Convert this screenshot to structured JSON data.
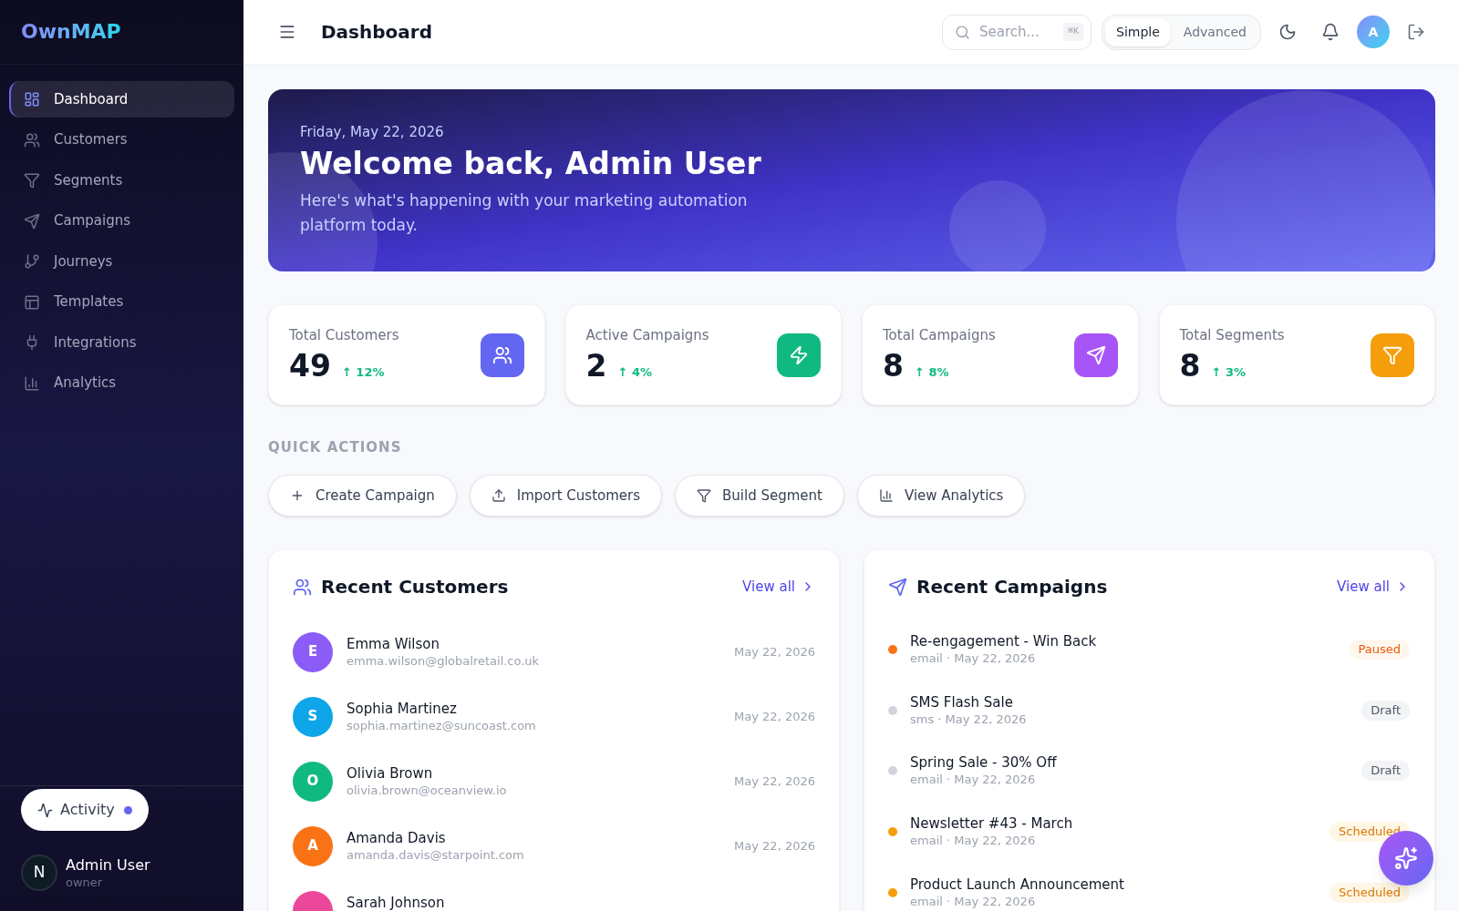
{
  "sidebar": {
    "logo": "OwnMAP",
    "items": [
      {
        "label": "Dashboard",
        "selected": true
      },
      {
        "label": "Customers",
        "selected": false
      },
      {
        "label": "Segments",
        "selected": false
      },
      {
        "label": "Campaigns",
        "selected": false
      },
      {
        "label": "Journeys",
        "selected": false
      },
      {
        "label": "Templates",
        "selected": false
      },
      {
        "label": "Integrations",
        "selected": false
      },
      {
        "label": "Analytics",
        "selected": false
      }
    ],
    "activity": {
      "label": "Activity",
      "unread": true
    },
    "user": {
      "avatar_letter": "N",
      "name": "Admin User",
      "role": "owner"
    }
  },
  "header": {
    "title": "Dashboard",
    "search": {
      "placeholder": "Search...",
      "shortcut": "⌘K"
    },
    "view_modes": [
      {
        "label": "Simple",
        "selected": true
      },
      {
        "label": "Advanced",
        "selected": false
      }
    ],
    "avatar_letter": "A"
  },
  "banner": {
    "date": "Friday, May 22, 2026",
    "title": "Welcome back, Admin User",
    "subtitle": "Here's what's happening with your marketing automation platform today."
  },
  "stats": [
    {
      "label": "Total Customers",
      "value": "49",
      "change": "↑ 12%",
      "color": "#6366f1"
    },
    {
      "label": "Active Campaigns",
      "value": "2",
      "change": "↑ 4%",
      "color": "#10b981"
    },
    {
      "label": "Total Campaigns",
      "value": "8",
      "change": "↑ 8%",
      "color": "#a855f7"
    },
    {
      "label": "Total Segments",
      "value": "8",
      "change": "↑ 3%",
      "color": "#f59e0b"
    }
  ],
  "quick_actions": {
    "title": "QUICK ACTIONS",
    "buttons": [
      "Create Campaign",
      "Import Customers",
      "Build Segment",
      "View Analytics"
    ]
  },
  "recent_customers": {
    "title": "Recent Customers",
    "view_all": "View all",
    "rows": [
      {
        "avatar_letter": "E",
        "name": "Emma Wilson",
        "email": "emma.wilson@globalretail.co.uk",
        "date": "May 22, 2026",
        "color": "#8b5cf6"
      },
      {
        "avatar_letter": "S",
        "name": "Sophia Martinez",
        "email": "sophia.martinez@suncoast.com",
        "date": "May 22, 2026",
        "color": "#0ea5e9"
      },
      {
        "avatar_letter": "O",
        "name": "Olivia Brown",
        "email": "olivia.brown@oceanview.io",
        "date": "May 22, 2026",
        "color": "#10b981"
      },
      {
        "avatar_letter": "A",
        "name": "Amanda Davis",
        "email": "amanda.davis@starpoint.com",
        "date": "May 22, 2026",
        "color": "#f97316"
      },
      {
        "name": "Sarah Johnson",
        "color": "#ec4899"
      }
    ]
  },
  "recent_campaigns": {
    "title": "Recent Campaigns",
    "view_all": "View all",
    "rows": [
      {
        "name": "Re-engagement - Win Back",
        "meta": "email · May 22, 2026",
        "status": "Paused",
        "kind": "paused",
        "color": "#f97316"
      },
      {
        "name": "SMS Flash Sale",
        "meta": "sms · May 22, 2026",
        "status": "Draft",
        "kind": "draft",
        "color": "#d1d5db"
      },
      {
        "name": "Spring Sale - 30% Off",
        "meta": "email · May 22, 2026",
        "status": "Draft",
        "kind": "draft",
        "color": "#d1d5db"
      },
      {
        "name": "Newsletter #43 - March",
        "meta": "email · May 22, 2026",
        "status": "Scheduled",
        "kind": "scheduled",
        "color": "#f59e0b"
      },
      {
        "name": "Product Launch Announcement",
        "meta": "email · May 22, 2026",
        "status": "Scheduled",
        "kind": "scheduled",
        "color": "#f59e0b"
      }
    ]
  }
}
